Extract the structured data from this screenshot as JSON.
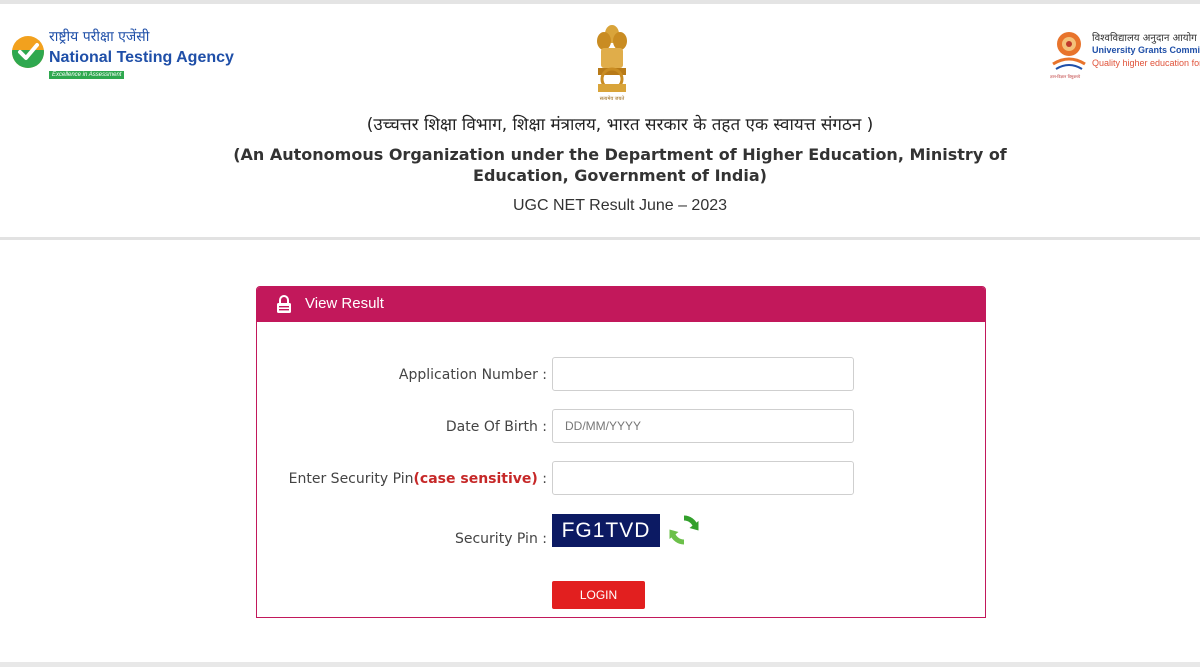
{
  "header": {
    "nta": {
      "hindi_name": "राष्ट्रीय परीक्षा एजेंसी",
      "english_name": "National Testing Agency",
      "tagline": "Excellence in Assessment"
    },
    "emblem": {
      "motto": "सत्यमेव जयते"
    },
    "ugc": {
      "hindi_name": "विश्वविद्यालय अनुदान आयोग",
      "english_name": "University Grants Commission",
      "tagline": "Quality higher education for all",
      "small_text": "ज्ञान-विज्ञान विमुक्तये"
    },
    "hindi_line": "(उच्चत्तर शिक्षा विभाग, शिक्षा मंत्रालय, भारत सरकार के तहत एक स्वायत्त संगठन )",
    "english_line": "(An Autonomous Organization under the Department of Higher Education, Ministry of Education, Government of India)",
    "subtitle": "UGC NET Result June – 2023"
  },
  "panel": {
    "title": "View Result",
    "icon": "lock-icon",
    "header_color": "#c2185b",
    "fields": {
      "application_number": {
        "label": "Application Number :",
        "value": "",
        "placeholder": ""
      },
      "date_of_birth": {
        "label": "Date Of Birth :",
        "value": "",
        "placeholder": "DD/MM/YYYY"
      },
      "security_pin": {
        "label_main": "Enter Security Pin",
        "label_note": "(case sensitive)",
        "label_suffix": " :",
        "value": "",
        "placeholder": ""
      }
    },
    "captcha": {
      "label": "Security Pin :",
      "code": "FG1TVD",
      "refresh_icon": "refresh-icon"
    },
    "login_button": "LOGIN",
    "login_color": "#e21f1f"
  }
}
